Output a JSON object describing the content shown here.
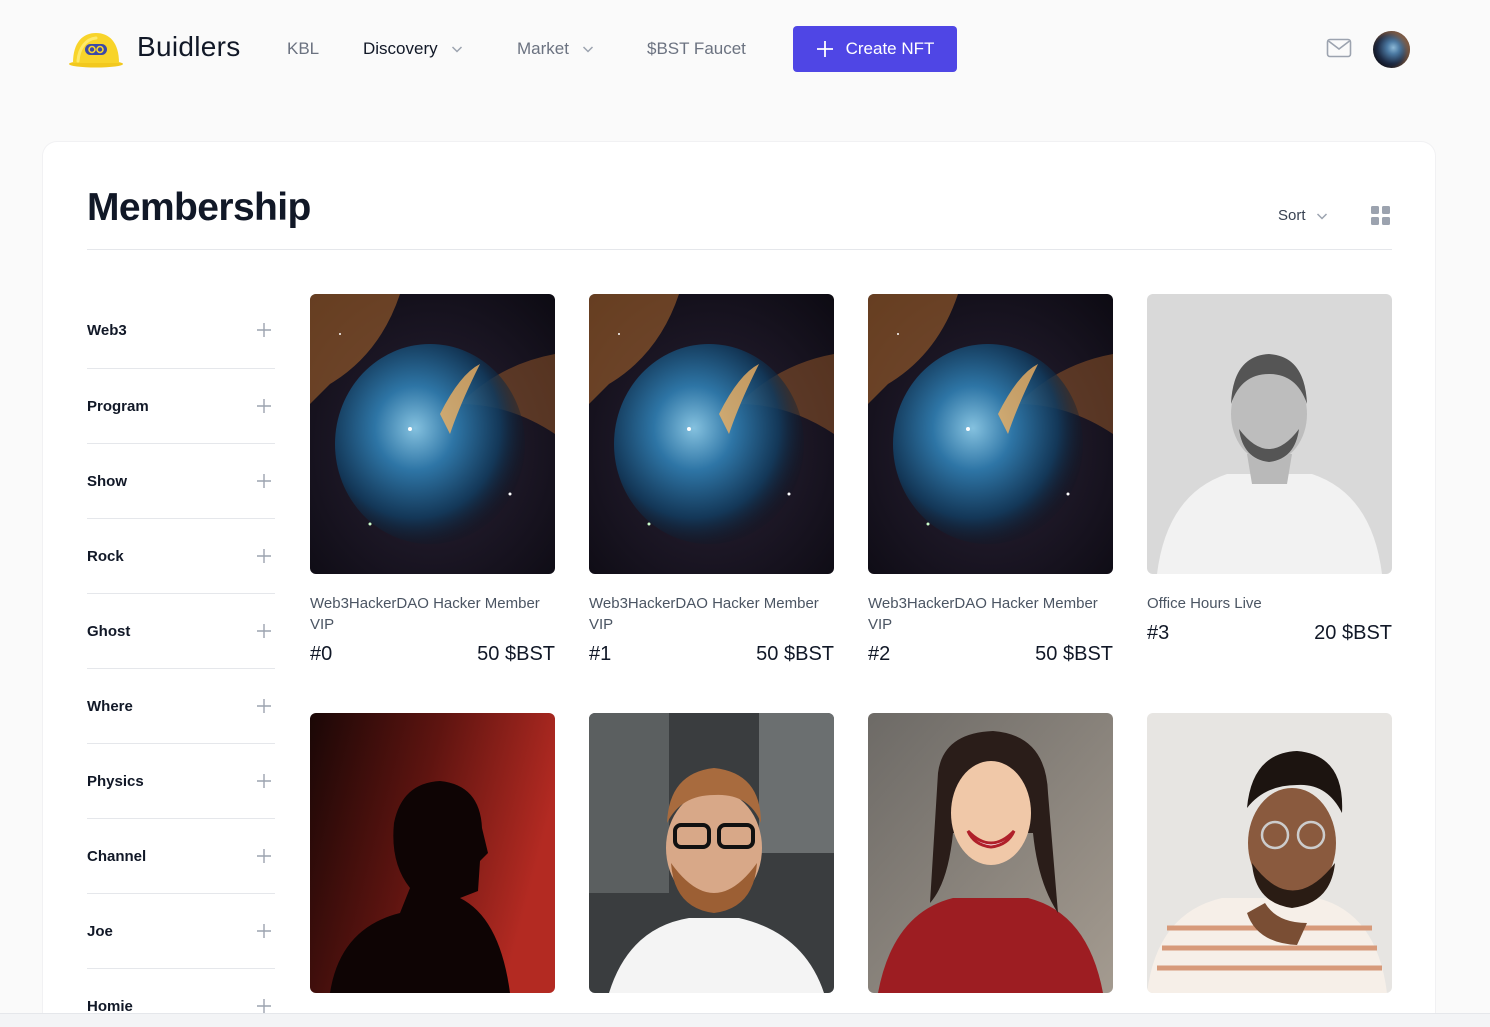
{
  "header": {
    "brand": "Buidlers",
    "nav": [
      {
        "label": "KBL"
      },
      {
        "label": "Discovery"
      },
      {
        "label": "Market"
      },
      {
        "label": "$BST Faucet"
      }
    ],
    "create_button": "Create NFT"
  },
  "page": {
    "title": "Membership",
    "sort_label": "Sort"
  },
  "filters": [
    {
      "label": "Web3"
    },
    {
      "label": "Program"
    },
    {
      "label": "Show"
    },
    {
      "label": "Rock"
    },
    {
      "label": "Ghost"
    },
    {
      "label": "Where"
    },
    {
      "label": "Physics"
    },
    {
      "label": "Channel"
    },
    {
      "label": "Joe"
    },
    {
      "label": "Homie"
    }
  ],
  "cards": [
    {
      "name": "Web3HackerDAO Hacker Member VIP",
      "id": "#0",
      "price": "50 $BST",
      "image": "nebula"
    },
    {
      "name": "Web3HackerDAO Hacker Member VIP",
      "id": "#1",
      "price": "50 $BST",
      "image": "nebula"
    },
    {
      "name": "Web3HackerDAO Hacker Member VIP",
      "id": "#2",
      "price": "50 $BST",
      "image": "nebula"
    },
    {
      "name": "Office Hours Live",
      "id": "#3",
      "price": "20 $BST",
      "image": "portrait-man-bw"
    },
    {
      "image": "portrait-silhouette-red"
    },
    {
      "image": "portrait-man-glasses"
    },
    {
      "image": "portrait-woman-smiling"
    },
    {
      "image": "portrait-man-curly"
    }
  ]
}
